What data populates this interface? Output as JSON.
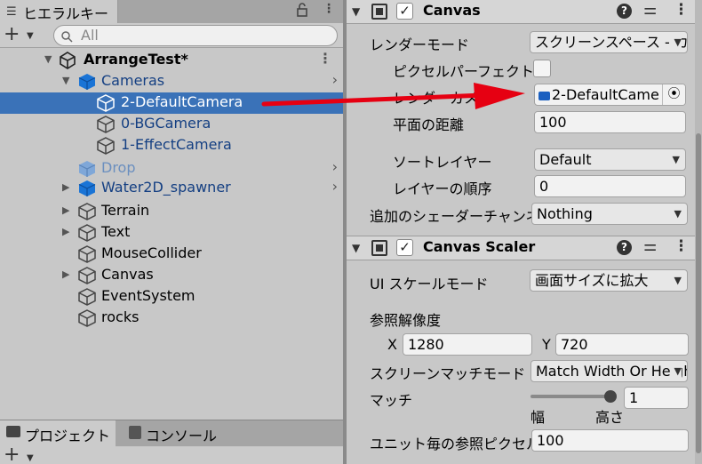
{
  "colors": {
    "selection": "#3a72b8",
    "annotation_arrow": "#e60012",
    "prefab_blue": "#1a74d6",
    "panel_bg": "#c8c8c8"
  },
  "hierarchy": {
    "tab_icon": "list-icon",
    "tab_label": "ヒエラルキー",
    "lock_icon": "lock-icon",
    "menu_icon": "kebab-icon",
    "add_symbol": "+",
    "search_placeholder": "All",
    "scene": {
      "name": "ArrangeTest*",
      "icon": "unity-logo-icon"
    },
    "items": [
      {
        "label": "Cameras",
        "depth": 1,
        "expanded": true,
        "prefab": true,
        "has_chevron": true
      },
      {
        "label": "2-DefaultCamera",
        "depth": 2,
        "selected": true,
        "prefab": false
      },
      {
        "label": "0-BGCamera",
        "depth": 2,
        "prefab": false
      },
      {
        "label": "1-EffectCamera",
        "depth": 2,
        "prefab": false
      },
      {
        "label": "Drop",
        "depth": 1,
        "prefab": true,
        "faded": true,
        "has_chevron": true
      },
      {
        "label": "Water2D_spawner",
        "depth": 1,
        "collapsed": true,
        "prefab": true,
        "has_chevron": true
      },
      {
        "label": "Terrain",
        "depth": 1,
        "collapsed": true
      },
      {
        "label": "Text",
        "depth": 1,
        "collapsed": true
      },
      {
        "label": "MouseCollider",
        "depth": 1
      },
      {
        "label": "Canvas",
        "depth": 1,
        "collapsed": true
      },
      {
        "label": "EventSystem",
        "depth": 1
      },
      {
        "label": "rocks",
        "depth": 1
      }
    ]
  },
  "bottom_tabs": {
    "project": "プロジェクト",
    "console": "コンソール",
    "add_symbol": "+"
  },
  "inspector": {
    "canvas": {
      "title": "Canvas",
      "render_mode_label": "レンダーモード",
      "render_mode_value": "スクリーンスペース - カ",
      "pixel_perfect_label": "ピクセルパーフェクト",
      "render_camera_label": "レンダーカメラ",
      "render_camera_value": "2-DefaultCame",
      "plane_distance_label": "平面の距離",
      "plane_distance_value": "100",
      "sorting_layer_label": "ソートレイヤー",
      "sorting_layer_value": "Default",
      "order_in_layer_label": "レイヤーの順序",
      "order_in_layer_value": "0",
      "shader_channels_label": "追加のシェーダーチャンネル",
      "shader_channels_value": "Nothing"
    },
    "canvas_scaler": {
      "title": "Canvas Scaler",
      "ui_scale_mode_label": "UI スケールモード",
      "ui_scale_mode_value": "画面サイズに拡大",
      "reference_resolution_label": "参照解像度",
      "x_label": "X",
      "x_value": "1280",
      "y_label": "Y",
      "y_value": "720",
      "screen_match_mode_label": "スクリーンマッチモード",
      "screen_match_mode_value": "Match Width Or Height",
      "match_label": "マッチ",
      "match_value": "1",
      "match_slider_fraction": 1.0,
      "slider_left_label": "幅",
      "slider_right_label": "高さ",
      "ref_pixels_label": "ユニット毎の参照ピクセル",
      "ref_pixels_value": "100"
    }
  }
}
